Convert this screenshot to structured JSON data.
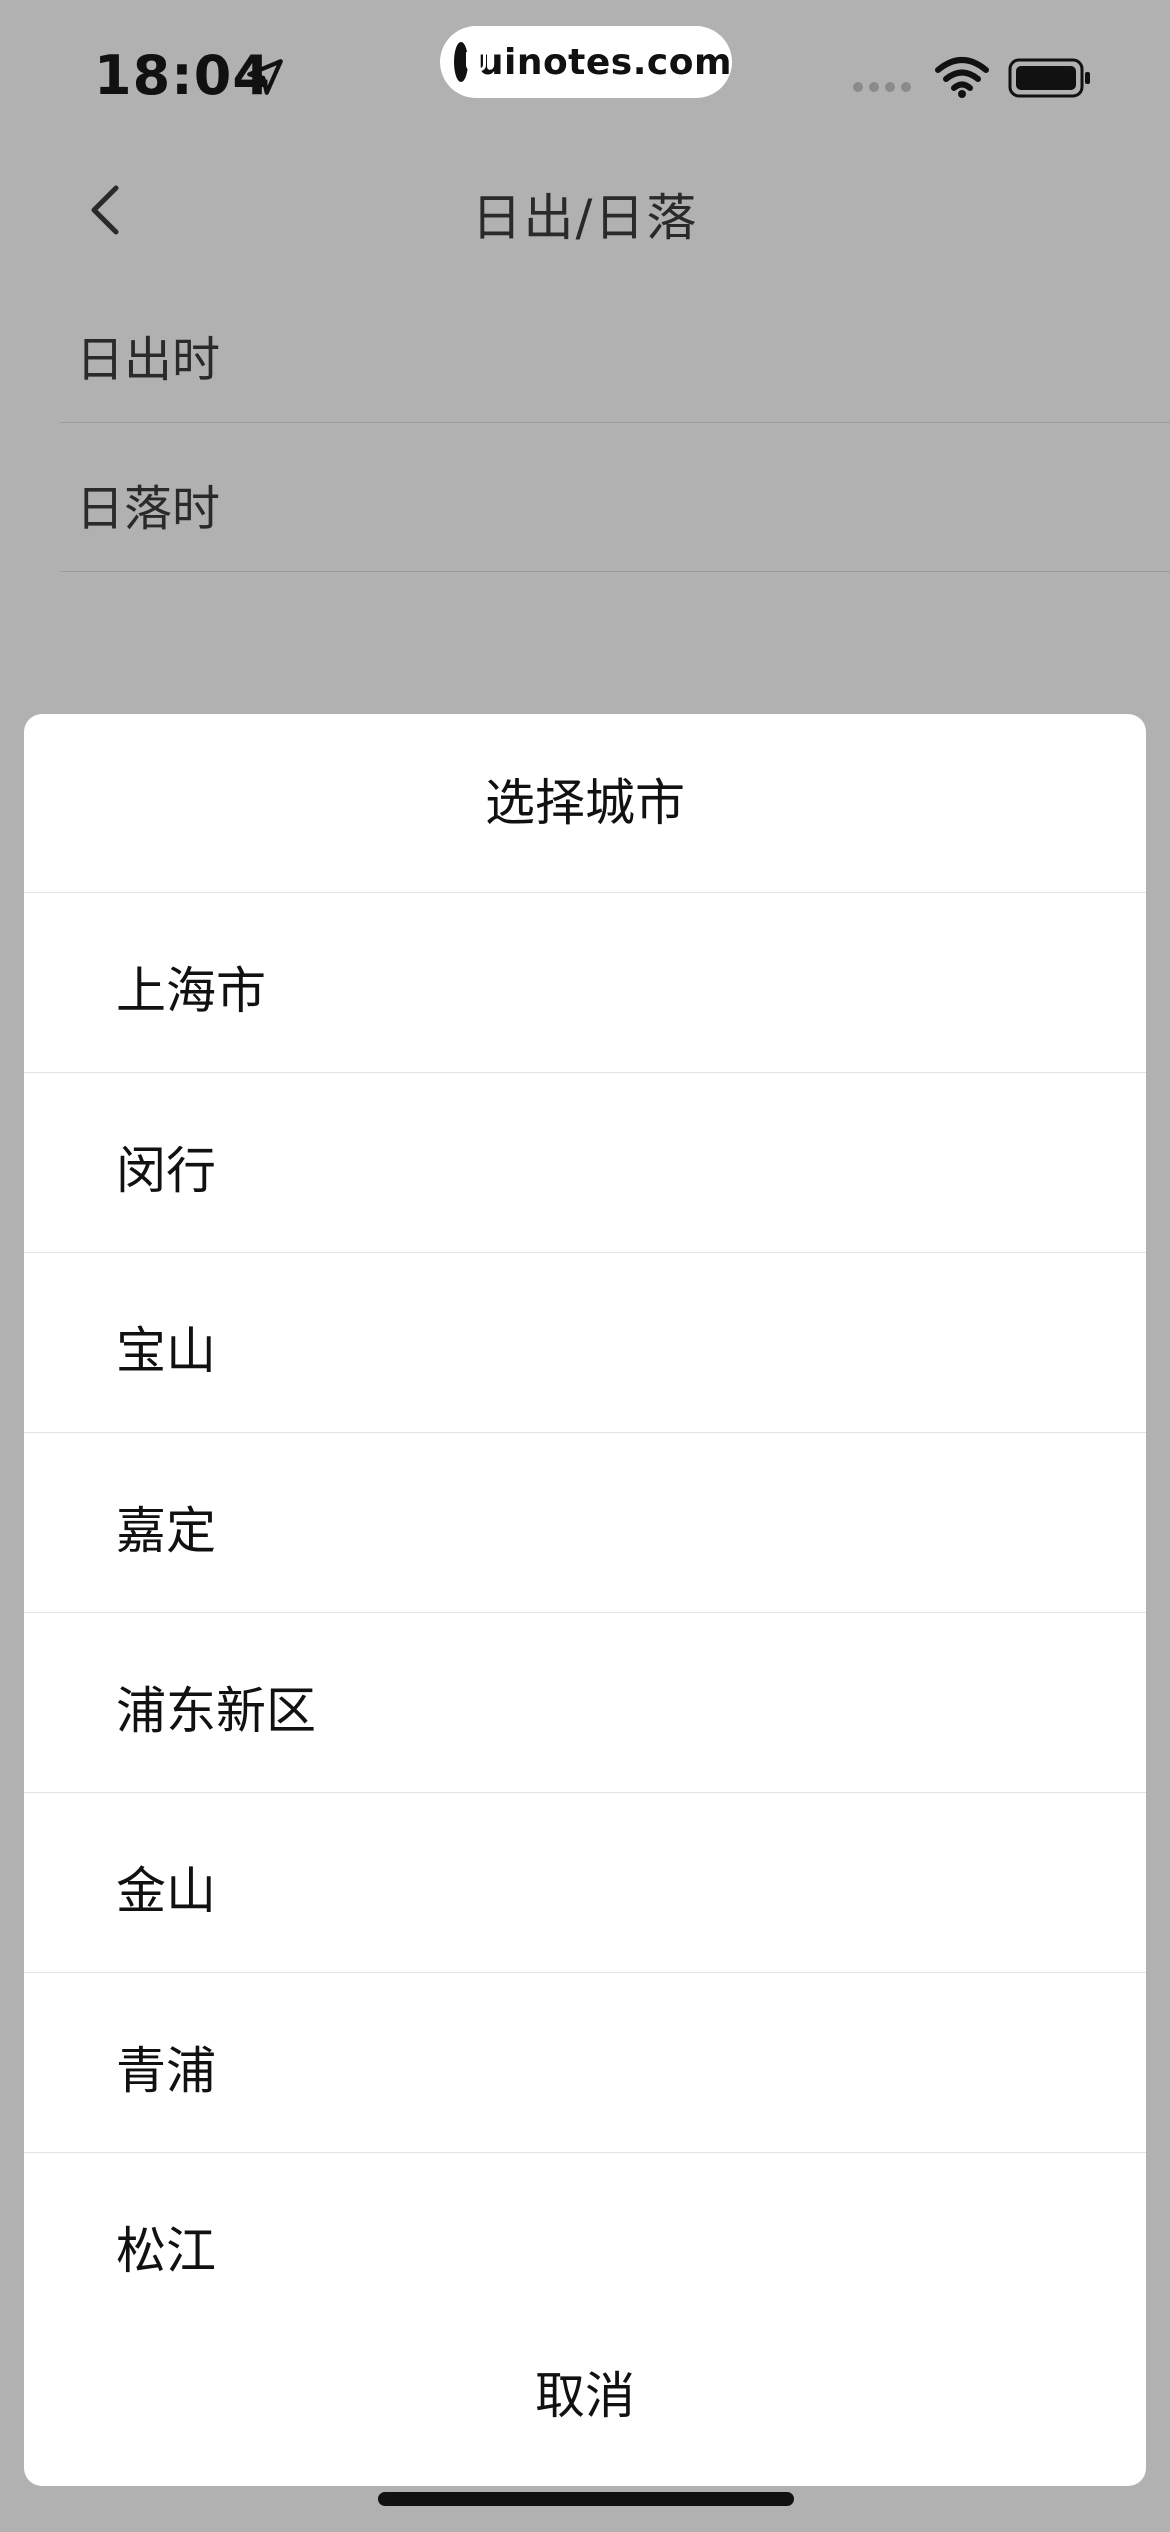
{
  "status_bar": {
    "time": "18:04",
    "watermark": "uinotes.com",
    "icons": [
      "location-arrow-icon",
      "cellular-signal-icon",
      "wifi-icon",
      "battery-icon"
    ]
  },
  "nav": {
    "title": "日出/日落",
    "back_icon": "chevron-left-icon"
  },
  "settings_rows": [
    {
      "label": "日出时"
    },
    {
      "label": "日落时"
    }
  ],
  "sheet": {
    "title": "选择城市",
    "options": [
      "上海市",
      "闵行",
      "宝山",
      "嘉定",
      "浦东新区",
      "金山",
      "青浦",
      "松江"
    ],
    "cancel_label": "取消"
  },
  "colors": {
    "overlay": "#b1b1b1",
    "sheet_bg": "#ffffff",
    "divider": "#e4e4e4",
    "text": "#111111"
  }
}
